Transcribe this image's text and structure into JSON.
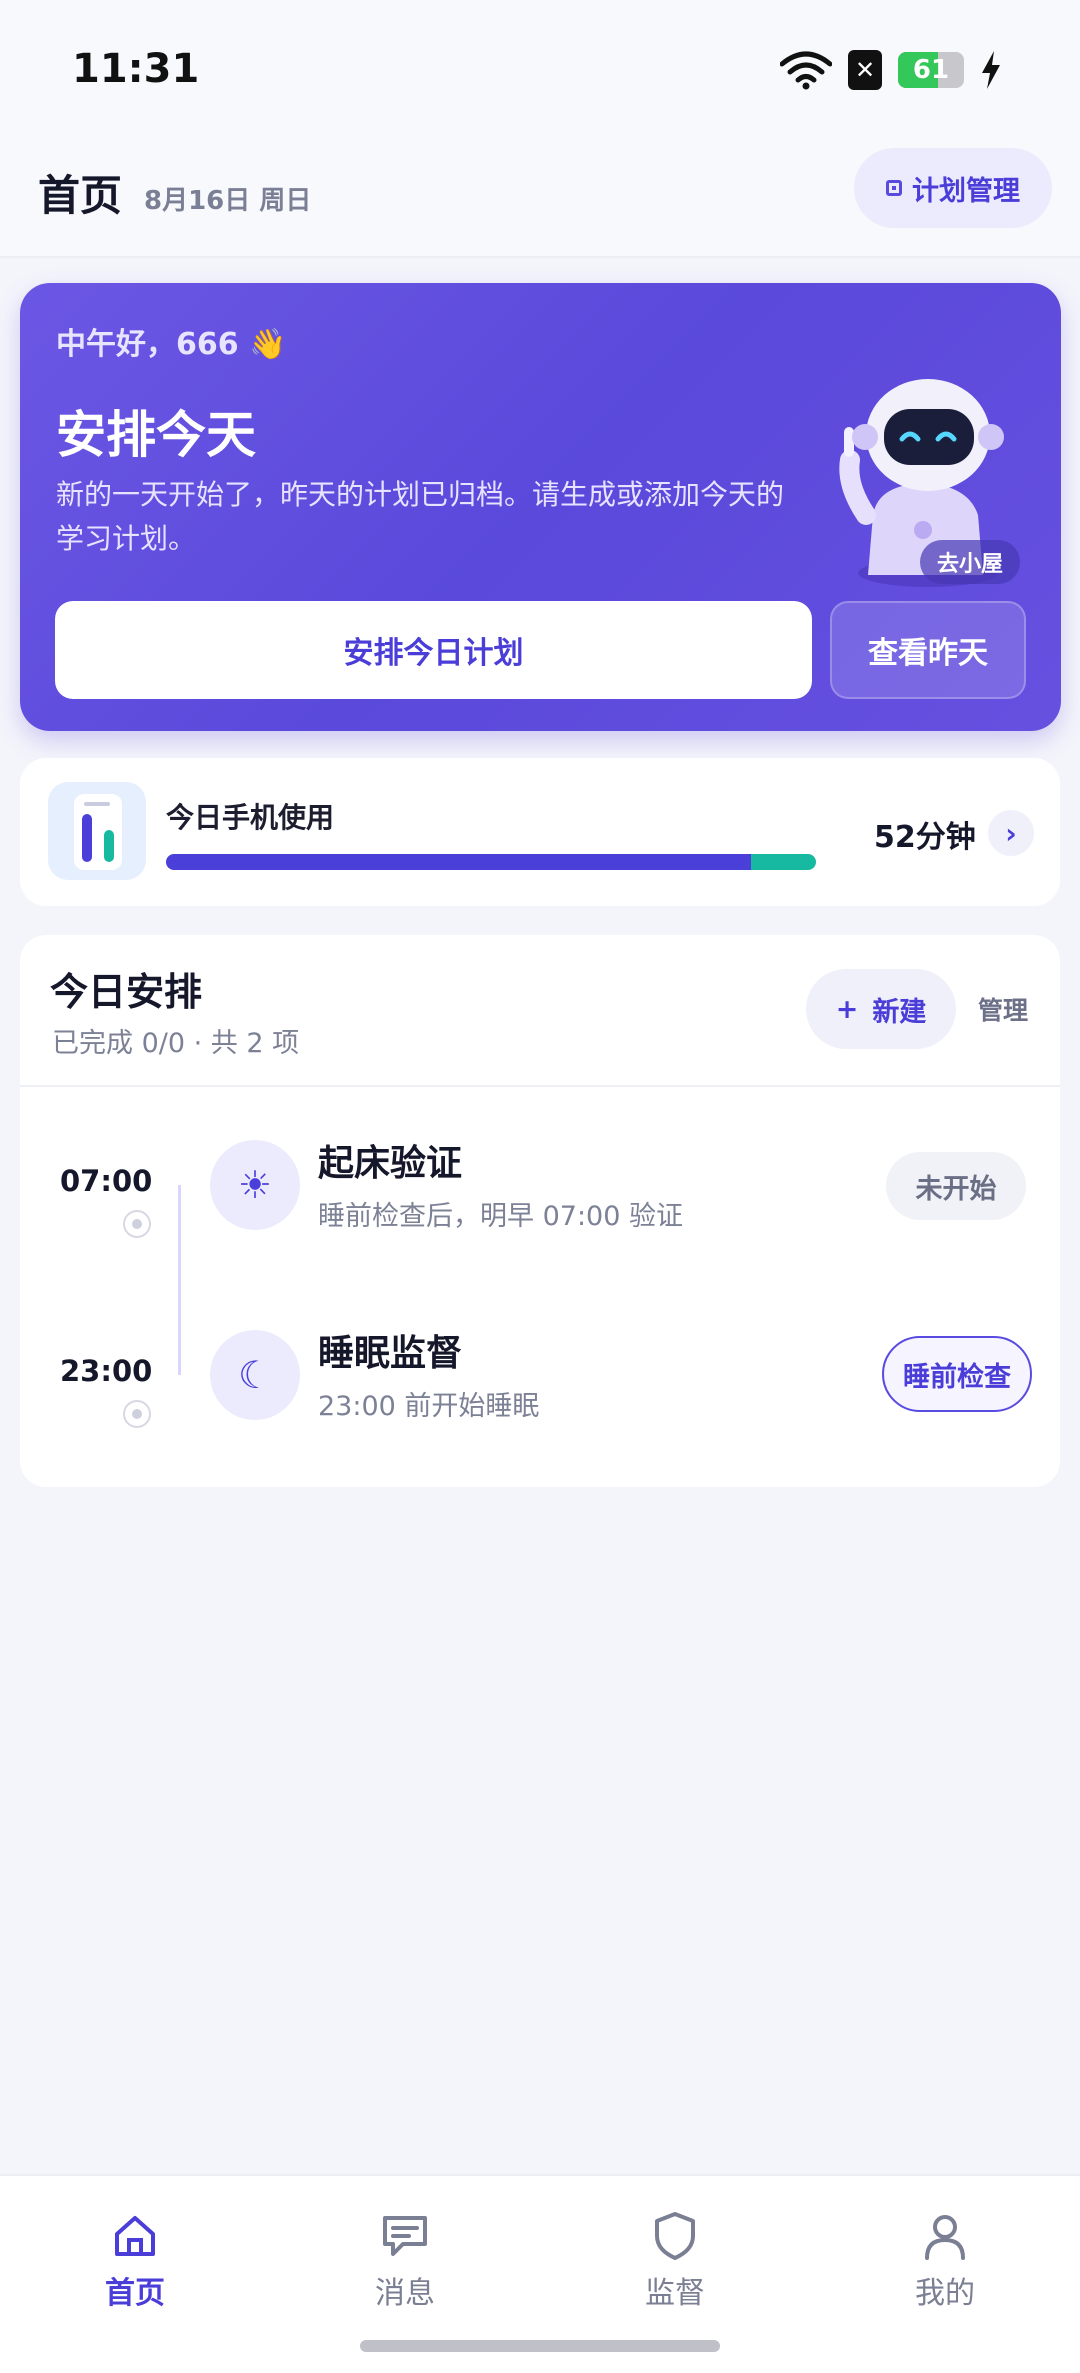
{
  "status_bar": {
    "time": "11:31",
    "battery": "61",
    "sim_icon": "sim-missing-icon"
  },
  "header": {
    "title": "首页",
    "date": "8月16日 周日",
    "plan_button": "计划管理"
  },
  "hero": {
    "greeting": "中午好，666 👋",
    "title": "安排今天",
    "description": "新的一天开始了，昨天的计划已归档。请生成或添加今天的学习计划。",
    "primary_button": "安排今日计划",
    "secondary_button": "查看昨天",
    "house_tag": "去小屋"
  },
  "phone_usage": {
    "label": "今日手机使用",
    "value": "52分钟",
    "main_fraction": 0.9,
    "secondary_fraction": 0.1,
    "colors": {
      "main": "#4b3fda",
      "secondary": "#17b9a0"
    }
  },
  "schedule": {
    "title": "今日安排",
    "subtitle": "已完成 0/0 · 共 2 项",
    "new_button": "新建",
    "manage_label": "管理",
    "items": [
      {
        "time": "07:00",
        "name": "起床验证",
        "desc": "睡前检查后，明早 07:00 验证",
        "status": "未开始",
        "icon": "sun-icon"
      },
      {
        "time": "23:00",
        "name": "睡眠监督",
        "desc": "23:00 前开始睡眠",
        "status": "睡前检查",
        "icon": "moon-icon"
      }
    ]
  },
  "bottom_nav": [
    {
      "label": "首页",
      "icon": "home-icon",
      "active": true
    },
    {
      "label": "消息",
      "icon": "message-icon",
      "active": false
    },
    {
      "label": "监督",
      "icon": "shield-icon",
      "active": false
    },
    {
      "label": "我的",
      "icon": "person-icon",
      "active": false
    }
  ],
  "colors": {
    "accent": "#4a3dd8",
    "hero": "#5a49db",
    "page_bg": "#f4f5fb"
  }
}
